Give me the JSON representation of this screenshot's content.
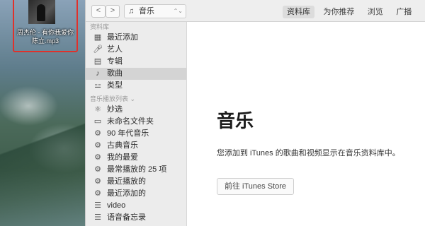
{
  "desktop": {
    "file_name": "周杰伦 - 有你我爱你 陈立.mp3"
  },
  "toolbar": {
    "back": "<",
    "forward": ">",
    "media_label": "音乐",
    "tabs": [
      "资料库",
      "为你推荐",
      "浏览",
      "广播"
    ],
    "active_tab": "资料库"
  },
  "sidebar": {
    "library_header": "资料库",
    "library_items": [
      {
        "label": "最近添加",
        "icon": "recently-added-icon"
      },
      {
        "label": "艺人",
        "icon": "artist-mic-icon"
      },
      {
        "label": "专辑",
        "icon": "album-icon"
      },
      {
        "label": "歌曲",
        "icon": "music-note-icon"
      },
      {
        "label": "类型",
        "icon": "genre-icon"
      }
    ],
    "selected_library_item": "歌曲",
    "playlists_header": "音乐播放列表 ⌄",
    "playlist_items": [
      {
        "label": "妙选",
        "icon": "genius-atom-icon"
      },
      {
        "label": "未命名文件夹",
        "icon": "folder-icon"
      },
      {
        "label": "90 年代音乐",
        "icon": "gear-icon"
      },
      {
        "label": "古典音乐",
        "icon": "gear-icon"
      },
      {
        "label": "我的最爱",
        "icon": "gear-icon"
      },
      {
        "label": "最常播放的 25 项",
        "icon": "gear-icon"
      },
      {
        "label": "最近播放的",
        "icon": "gear-icon"
      },
      {
        "label": "最近添加的",
        "icon": "gear-icon"
      },
      {
        "label": "video",
        "icon": "playlist-icon"
      },
      {
        "label": "语音备忘录",
        "icon": "playlist-icon"
      }
    ]
  },
  "main": {
    "title": "音乐",
    "description": "您添加到 iTunes 的歌曲和视频显示在音乐资料库中。",
    "store_button": "前往 iTunes Store"
  }
}
